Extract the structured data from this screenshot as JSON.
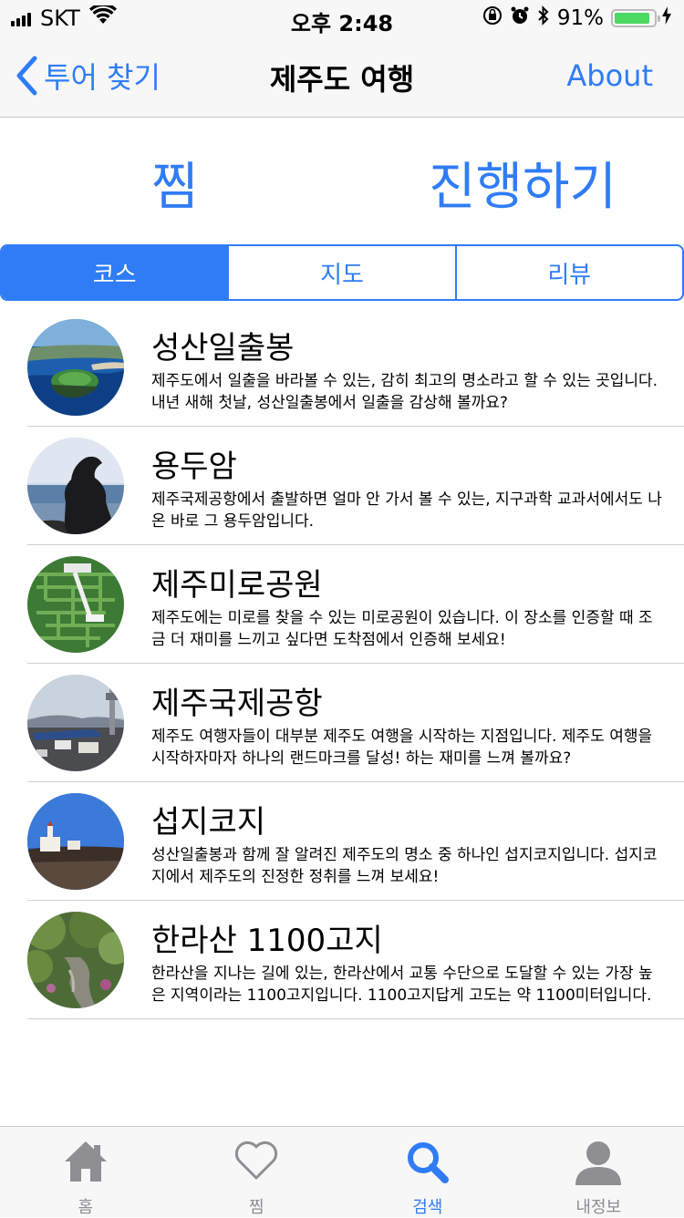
{
  "status_bar": {
    "carrier": "SKT",
    "time": "오후 2:48",
    "battery_percent": "91%",
    "battery_level": 0.91,
    "icons": [
      "signal-icon",
      "wifi-icon",
      "rotation-lock-icon",
      "alarm-icon",
      "bluetooth-icon",
      "battery-icon",
      "charging-icon"
    ]
  },
  "nav": {
    "back_label": "투어 찾기",
    "title": "제주도 여행",
    "about_label": "About"
  },
  "actions": {
    "save_label": "찜",
    "start_label": "진행하기"
  },
  "segments": [
    {
      "label": "코스",
      "selected": true
    },
    {
      "label": "지도",
      "selected": false
    },
    {
      "label": "리뷰",
      "selected": false
    }
  ],
  "courses": [
    {
      "title": "성산일출봉",
      "desc": "제주도에서 일출을 바라볼 수 있는, 감히 최고의 명소라고 할 수 있는 곳입니다. 내년 새해 첫날, 성산일출봉에서 일출을 감상해 볼까요?"
    },
    {
      "title": "용두암",
      "desc": "제주국제공항에서 출발하면 얼마 안 가서 볼 수 있는, 지구과학 교과서에서도 나온 바로 그 용두암입니다."
    },
    {
      "title": "제주미로공원",
      "desc": "제주도에는 미로를 찾을 수 있는 미로공원이 있습니다. 이 장소를 인증할 때 조금 더 재미를 느끼고 싶다면 도착점에서 인증해 보세요!"
    },
    {
      "title": "제주국제공항",
      "desc": "제주도 여행자들이 대부분 제주도 여행을 시작하는 지점입니다. 제주도 여행을 시작하자마자 하나의 랜드마크를 달성! 하는 재미를 느껴 볼까요?"
    },
    {
      "title": "섭지코지",
      "desc": "성산일출봉과 함께 잘 알려진 제주도의 명소 중 하나인 섭지코지입니다. 섭지코지에서 제주도의 진정한 정취를 느껴 보세요!"
    },
    {
      "title": "한라산 1100고지",
      "desc": "한라산을 지나는 길에 있는, 한라산에서 교통 수단으로 도달할 수 있는 가장 높은 지역이라는 1100고지입니다. 1100고지답게 고도는 약 1100미터입니다."
    }
  ],
  "tabs": [
    {
      "label": "홈",
      "icon": "home-icon",
      "active": false
    },
    {
      "label": "찜",
      "icon": "heart-icon",
      "active": false
    },
    {
      "label": "검색",
      "icon": "search-icon",
      "active": true
    },
    {
      "label": "내정보",
      "icon": "profile-icon",
      "active": false
    }
  ],
  "colors": {
    "accent": "#2f7cf6",
    "bar_background": "#f7f7f7",
    "inactive_tab": "#8e8e93",
    "battery_fill": "#4cd964"
  }
}
